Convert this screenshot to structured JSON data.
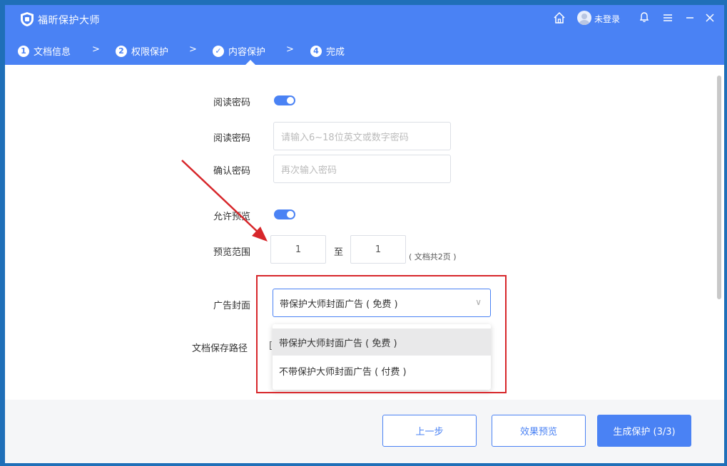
{
  "app": {
    "title": "福昕保护大师",
    "login_label": "未登录"
  },
  "header_icons": [
    "home-icon",
    "user-avatar",
    "bell-icon",
    "menu-icon",
    "minimize-icon",
    "close-icon"
  ],
  "steps": [
    {
      "num": "1",
      "label": "文档信息"
    },
    {
      "num": "2",
      "label": "权限保护"
    },
    {
      "num": "✓",
      "label": "内容保护"
    },
    {
      "num": "4",
      "label": "完成"
    }
  ],
  "form": {
    "read_password_toggle_label": "阅读密码",
    "read_password_label": "阅读密码",
    "read_password_placeholder": "请输入6~18位英文或数字密码",
    "confirm_password_label": "确认密码",
    "confirm_password_placeholder": "再次输入密码",
    "allow_preview_label": "允许预览",
    "preview_range_label": "预览范围",
    "preview_from": "1",
    "preview_to_separator": "至",
    "preview_to": "1",
    "page_count_note": "( 文档共2页 )",
    "ad_cover_label": "广告封面",
    "ad_cover_selected": "带保护大师封面广告 ( 免费 )",
    "ad_cover_options": [
      "带保护大师封面广告 ( 免费 )",
      "不带保护大师封面广告 ( 付费 )"
    ],
    "save_path_label": "文档保存路径",
    "save_path_partial": "["
  },
  "footer": {
    "prev_label": "上一步",
    "preview_label": "效果预览",
    "generate_label": "生成保护 (3/3)"
  },
  "colors": {
    "primary": "#4a82f4",
    "highlight_box": "#d7262a",
    "arrow": "#d7262a"
  }
}
